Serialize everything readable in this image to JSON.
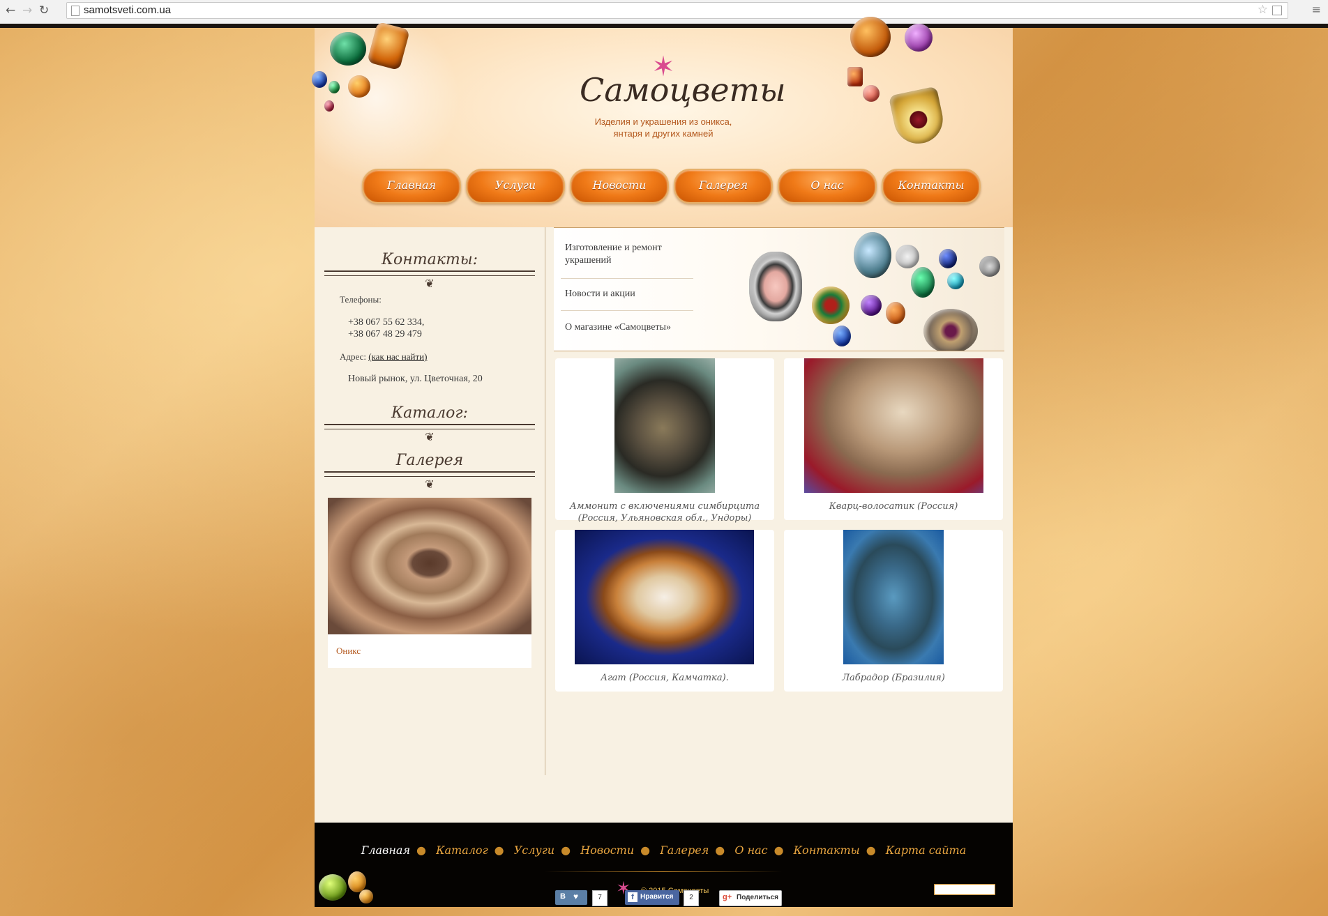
{
  "browser": {
    "url": "samotsveti.com.ua"
  },
  "site": {
    "title": "Самоцветы",
    "subtitle_line1": "Изделия и украшения из оникса,",
    "subtitle_line2": "янтаря и других камней"
  },
  "nav": [
    "Главная",
    "Услуги",
    "Новости",
    "Галерея",
    "О нас",
    "Контакты"
  ],
  "sidebar": {
    "contacts_title": "Контакты:",
    "phones_label": "Телефоны:",
    "phone1": "+38 067 55 62 334,",
    "phone2": "+38 067 48 29 479",
    "address_label": "Адрес:",
    "address_link": "(как нас найти)",
    "address": "Новый рынок, ул. Цветочная, 20",
    "catalog_title": "Каталог:",
    "gallery_title": "Галерея",
    "gallery_caption": "Оникс"
  },
  "banner": {
    "links": [
      "Изготовление и ремонт украшений",
      "Новости и акции",
      "О магазине «Самоцветы»"
    ]
  },
  "gallery": [
    {
      "caption": "Аммонит с включениями симбирцита (Россия, Ульяновская обл., Ундоры)"
    },
    {
      "caption": "Кварц-волосатик (Россия)"
    },
    {
      "caption": "Агат (Россия, Камчатка)."
    },
    {
      "caption": "Лабрадор (Бразилия)"
    }
  ],
  "footer": {
    "links": [
      "Главная",
      "Каталог",
      "Услуги",
      "Новости",
      "Галерея",
      "О нас",
      "Контакты",
      "Карта сайта"
    ],
    "copyright": "© 2015 Самоцветы"
  },
  "social": {
    "vk_label": "В",
    "vk_count": "7",
    "fb_label": "Нравится",
    "fb_count": "2",
    "gplus_label": "Поделиться"
  },
  "colors": {
    "accent": "#f07a18",
    "footer_link": "#e8a540",
    "footer_active": "#ffffff"
  }
}
